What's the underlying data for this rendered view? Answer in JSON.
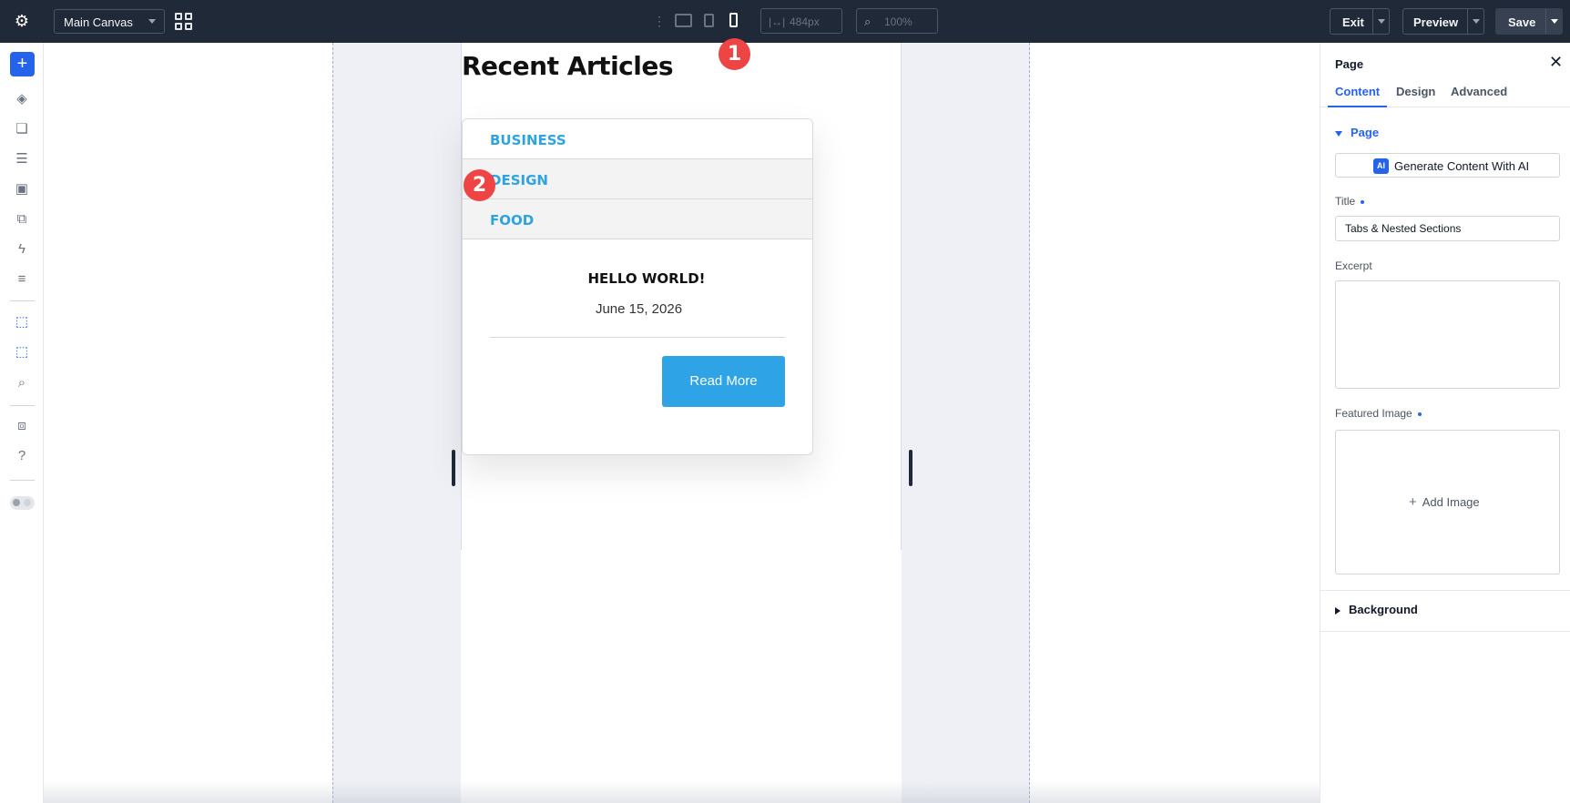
{
  "topbar": {
    "canvas_select": "Main Canvas",
    "width_value": "484px",
    "zoom_value": "100%",
    "exit_label": "Exit",
    "preview_label": "Preview",
    "save_label": "Save"
  },
  "canvas": {
    "heading": "Recent Articles",
    "tabs": [
      {
        "label": "BUSINESS"
      },
      {
        "label": "DESIGN"
      },
      {
        "label": "FOOD"
      }
    ],
    "post": {
      "title": "HELLO WORLD!",
      "date": "June 15, 2026",
      "button_label": "Read More"
    },
    "tab_color": "#2ea3e0",
    "button_color": "#2ea3e6"
  },
  "annotations": {
    "badge_1": "1",
    "badge_2": "2",
    "color": "#ef4444"
  },
  "right_panel": {
    "title": "Page",
    "tabs": [
      {
        "label": "Content",
        "active": true
      },
      {
        "label": "Design",
        "active": false
      },
      {
        "label": "Advanced",
        "active": false
      }
    ],
    "section_page": "Page",
    "generate_button": "Generate Content With AI",
    "ai_badge": "AI",
    "title_label": "Title",
    "title_value": "Tabs & Nested Sections",
    "excerpt_label": "Excerpt",
    "featured_image_label": "Featured Image",
    "add_image_label": "Add Image",
    "section_background": "Background",
    "accent_color": "#2563eb"
  }
}
